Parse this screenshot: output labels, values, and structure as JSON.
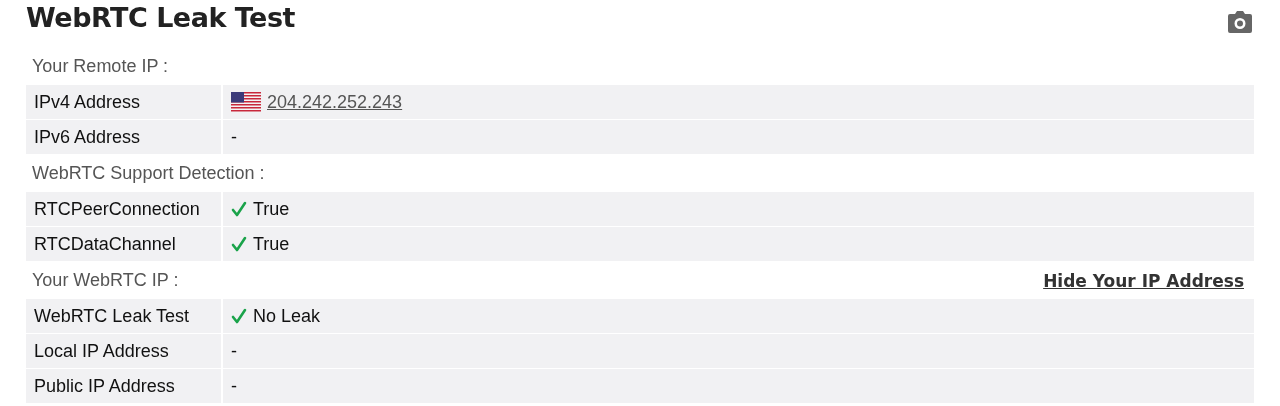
{
  "title": "WebRTC Leak Test",
  "sections": [
    {
      "heading": "Your Remote IP :",
      "rows": [
        {
          "label": "IPv4 Address",
          "kind": "link",
          "value": "204.242.252.243"
        },
        {
          "label": "IPv6 Address",
          "kind": "text",
          "value": "-"
        }
      ]
    },
    {
      "heading": "WebRTC Support Detection :",
      "rows": [
        {
          "label": "RTCPeerConnection",
          "kind": "check",
          "value": "True"
        },
        {
          "label": "RTCDataChannel",
          "kind": "check",
          "value": "True"
        }
      ]
    },
    {
      "heading": "Your WebRTC IP :",
      "action": "Hide Your IP Address",
      "rows": [
        {
          "label": "WebRTC Leak Test",
          "kind": "check",
          "value": "No Leak"
        },
        {
          "label": "Local IP Address",
          "kind": "text",
          "value": "-"
        },
        {
          "label": "Public IP Address",
          "kind": "text",
          "value": "-"
        }
      ]
    }
  ]
}
